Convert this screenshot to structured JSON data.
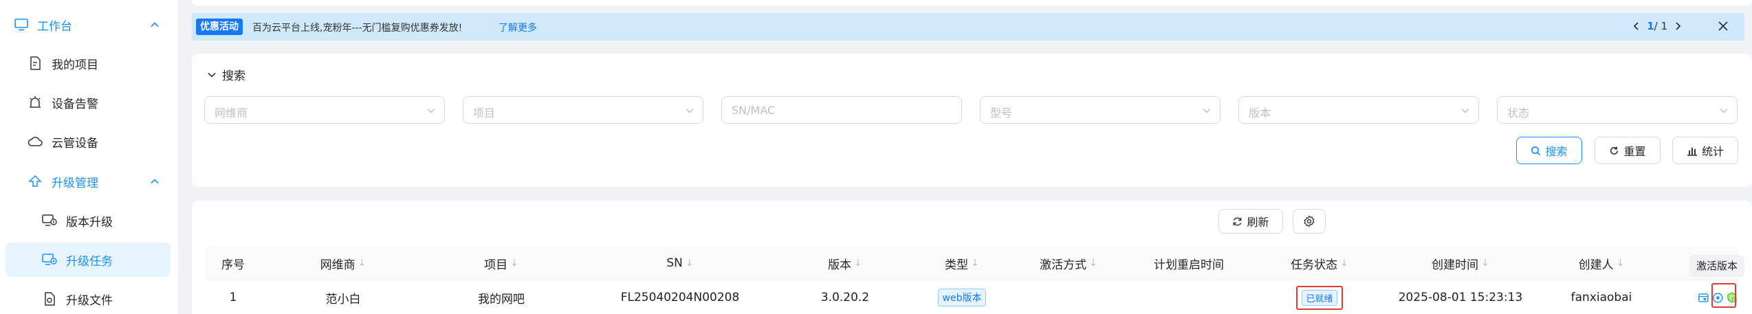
{
  "sidebar": {
    "items": [
      {
        "label": "工作台",
        "icon": "monitor-icon"
      },
      {
        "label": "我的项目",
        "icon": "project-icon"
      },
      {
        "label": "设备告警",
        "icon": "alarm-icon"
      },
      {
        "label": "云管设备",
        "icon": "cloud-icon"
      },
      {
        "label": "升级管理",
        "icon": "upgrade-icon"
      },
      {
        "label": "版本升级",
        "icon": "version-upgrade-icon"
      },
      {
        "label": "升级任务",
        "icon": "task-icon"
      },
      {
        "label": "升级文件",
        "icon": "file-icon"
      }
    ]
  },
  "banner": {
    "tag": "优惠活动",
    "message": "百为云平台上线,宠粉年---无门槛复购优惠券发放!",
    "more": "了解更多",
    "page_current": "1",
    "page_total": "/ 1"
  },
  "search": {
    "title": "搜索",
    "fields": [
      {
        "placeholder": "网维商"
      },
      {
        "placeholder": "项目"
      },
      {
        "placeholder": "SN/MAC"
      },
      {
        "placeholder": "型号"
      },
      {
        "placeholder": "版本"
      },
      {
        "placeholder": "状态"
      }
    ],
    "search_label": "搜索",
    "reset_label": "重置",
    "stats_label": "统计"
  },
  "table": {
    "refresh_label": "刷新",
    "columns": [
      "序号",
      "网维商",
      "项目",
      "SN",
      "版本",
      "类型",
      "激活方式",
      "计划重启时间",
      "任务状态",
      "创建时间",
      "创建人"
    ],
    "rows": [
      {
        "index": "1",
        "vendor": "范小白",
        "project": "我的网吧",
        "sn": "FL25040204N00208",
        "version": "3.0.20.2",
        "type": "web版本",
        "activation": "",
        "reboot_time": "",
        "status": "已就绪",
        "created_at": "2025-08-01 15:23:13",
        "creator": "fanxiaobai"
      }
    ]
  },
  "tooltip": {
    "text": "激活版本"
  },
  "colors": {
    "accent": "#1890ff",
    "highlight": "#e53935",
    "banner_bg": "#cfe9fa"
  }
}
